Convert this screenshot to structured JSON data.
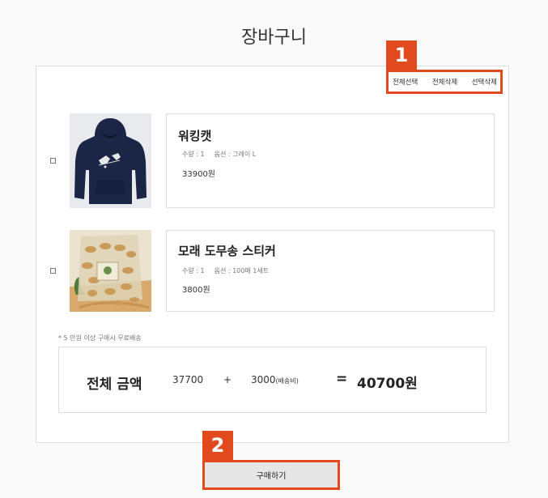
{
  "page_title": "장바구니",
  "annotations": {
    "badge_1": "1",
    "badge_2": "2"
  },
  "actions": {
    "select_all": "전체선택",
    "delete_all": "전체삭제",
    "delete_selected": "선택삭제"
  },
  "items": [
    {
      "name": "워킹캣",
      "qty_label": "수량 : 1",
      "option_label": "옵션 : 그레이 L",
      "price": "33900원",
      "image": "navy-hoodie"
    },
    {
      "name": "모래 도무송 스티커",
      "qty_label": "수량 : 1",
      "option_label": "옵션 : 100매 1세트",
      "price": "3800원",
      "image": "cashew-snack-bag"
    }
  ],
  "shipping_note": "* 5 만원 이상 구매시 무료배송",
  "total": {
    "label": "전체 금액",
    "subtotal": "37700",
    "plus": "+",
    "shipping": "3000",
    "shipping_label": "(배송비)",
    "equals": "=",
    "grand_total": "40700원"
  },
  "buy_button": "구매하기",
  "colors": {
    "highlight": "#e04a1c",
    "navy": "#1b2546"
  }
}
